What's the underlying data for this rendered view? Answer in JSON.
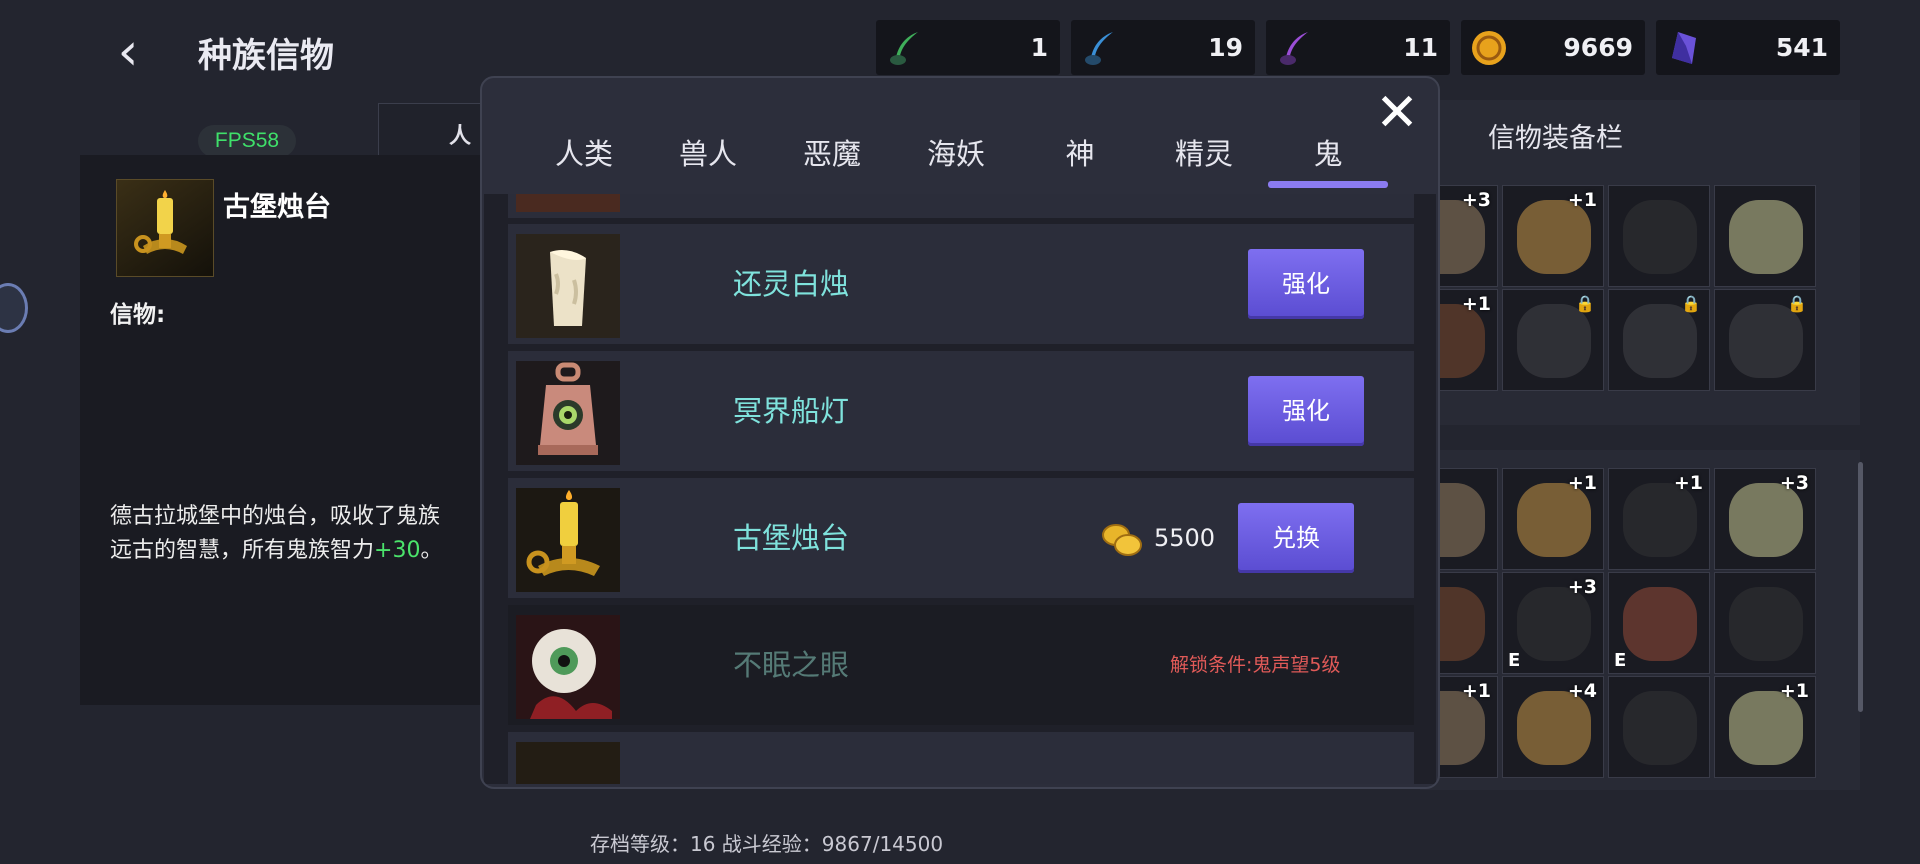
{
  "header": {
    "title": "种族信物"
  },
  "currencies": [
    {
      "icon": "green-quill-icon",
      "value": "1",
      "color": "#3fae5a"
    },
    {
      "icon": "blue-quill-icon",
      "value": "19",
      "color": "#3a8fd6"
    },
    {
      "icon": "purple-quill-icon",
      "value": "11",
      "color": "#9b4ed6"
    },
    {
      "icon": "gold-coin-icon",
      "value": "9669",
      "color": "#e8a21c"
    },
    {
      "icon": "purple-crystal-icon",
      "value": "541",
      "color": "#6a52d8"
    }
  ],
  "fps": "FPS58",
  "detail": {
    "name": "古堡烛台",
    "label": "信物:",
    "desc_pre": "德古拉城堡中的烛台，吸收了鬼族远古的智慧，所有鬼族智力",
    "desc_bonus": "+30",
    "desc_post": "。"
  },
  "equip_panel": {
    "title": "信物装备栏"
  },
  "footer": {
    "stats": "存档等级：16 战斗经验：9867/14500"
  },
  "modal": {
    "tabs": [
      "人类",
      "兽人",
      "恶魔",
      "海妖",
      "神",
      "精灵",
      "鬼"
    ],
    "active_tab": "鬼",
    "items": [
      {
        "name": "还灵白烛",
        "button": "强化",
        "locked": false
      },
      {
        "name": "冥界船灯",
        "button": "强化",
        "locked": false
      },
      {
        "name": "古堡烛台",
        "price": "5500",
        "button": "兑换",
        "locked": false
      },
      {
        "name": "不眠之眼",
        "unlock_text": "解锁条件:鬼声望5级",
        "locked": true
      }
    ]
  },
  "equip_slots": [
    "+3",
    "+1",
    "",
    "",
    "+1",
    "",
    "",
    ""
  ],
  "inventory_slots": [
    "",
    "+1",
    "+1",
    "+3",
    "",
    "+3",
    "",
    "",
    "+1",
    "+4",
    "",
    "+1"
  ],
  "inventory_e_marks": [
    "",
    "",
    "",
    "",
    "",
    "E",
    "E",
    "",
    "",
    "",
    "",
    ""
  ]
}
